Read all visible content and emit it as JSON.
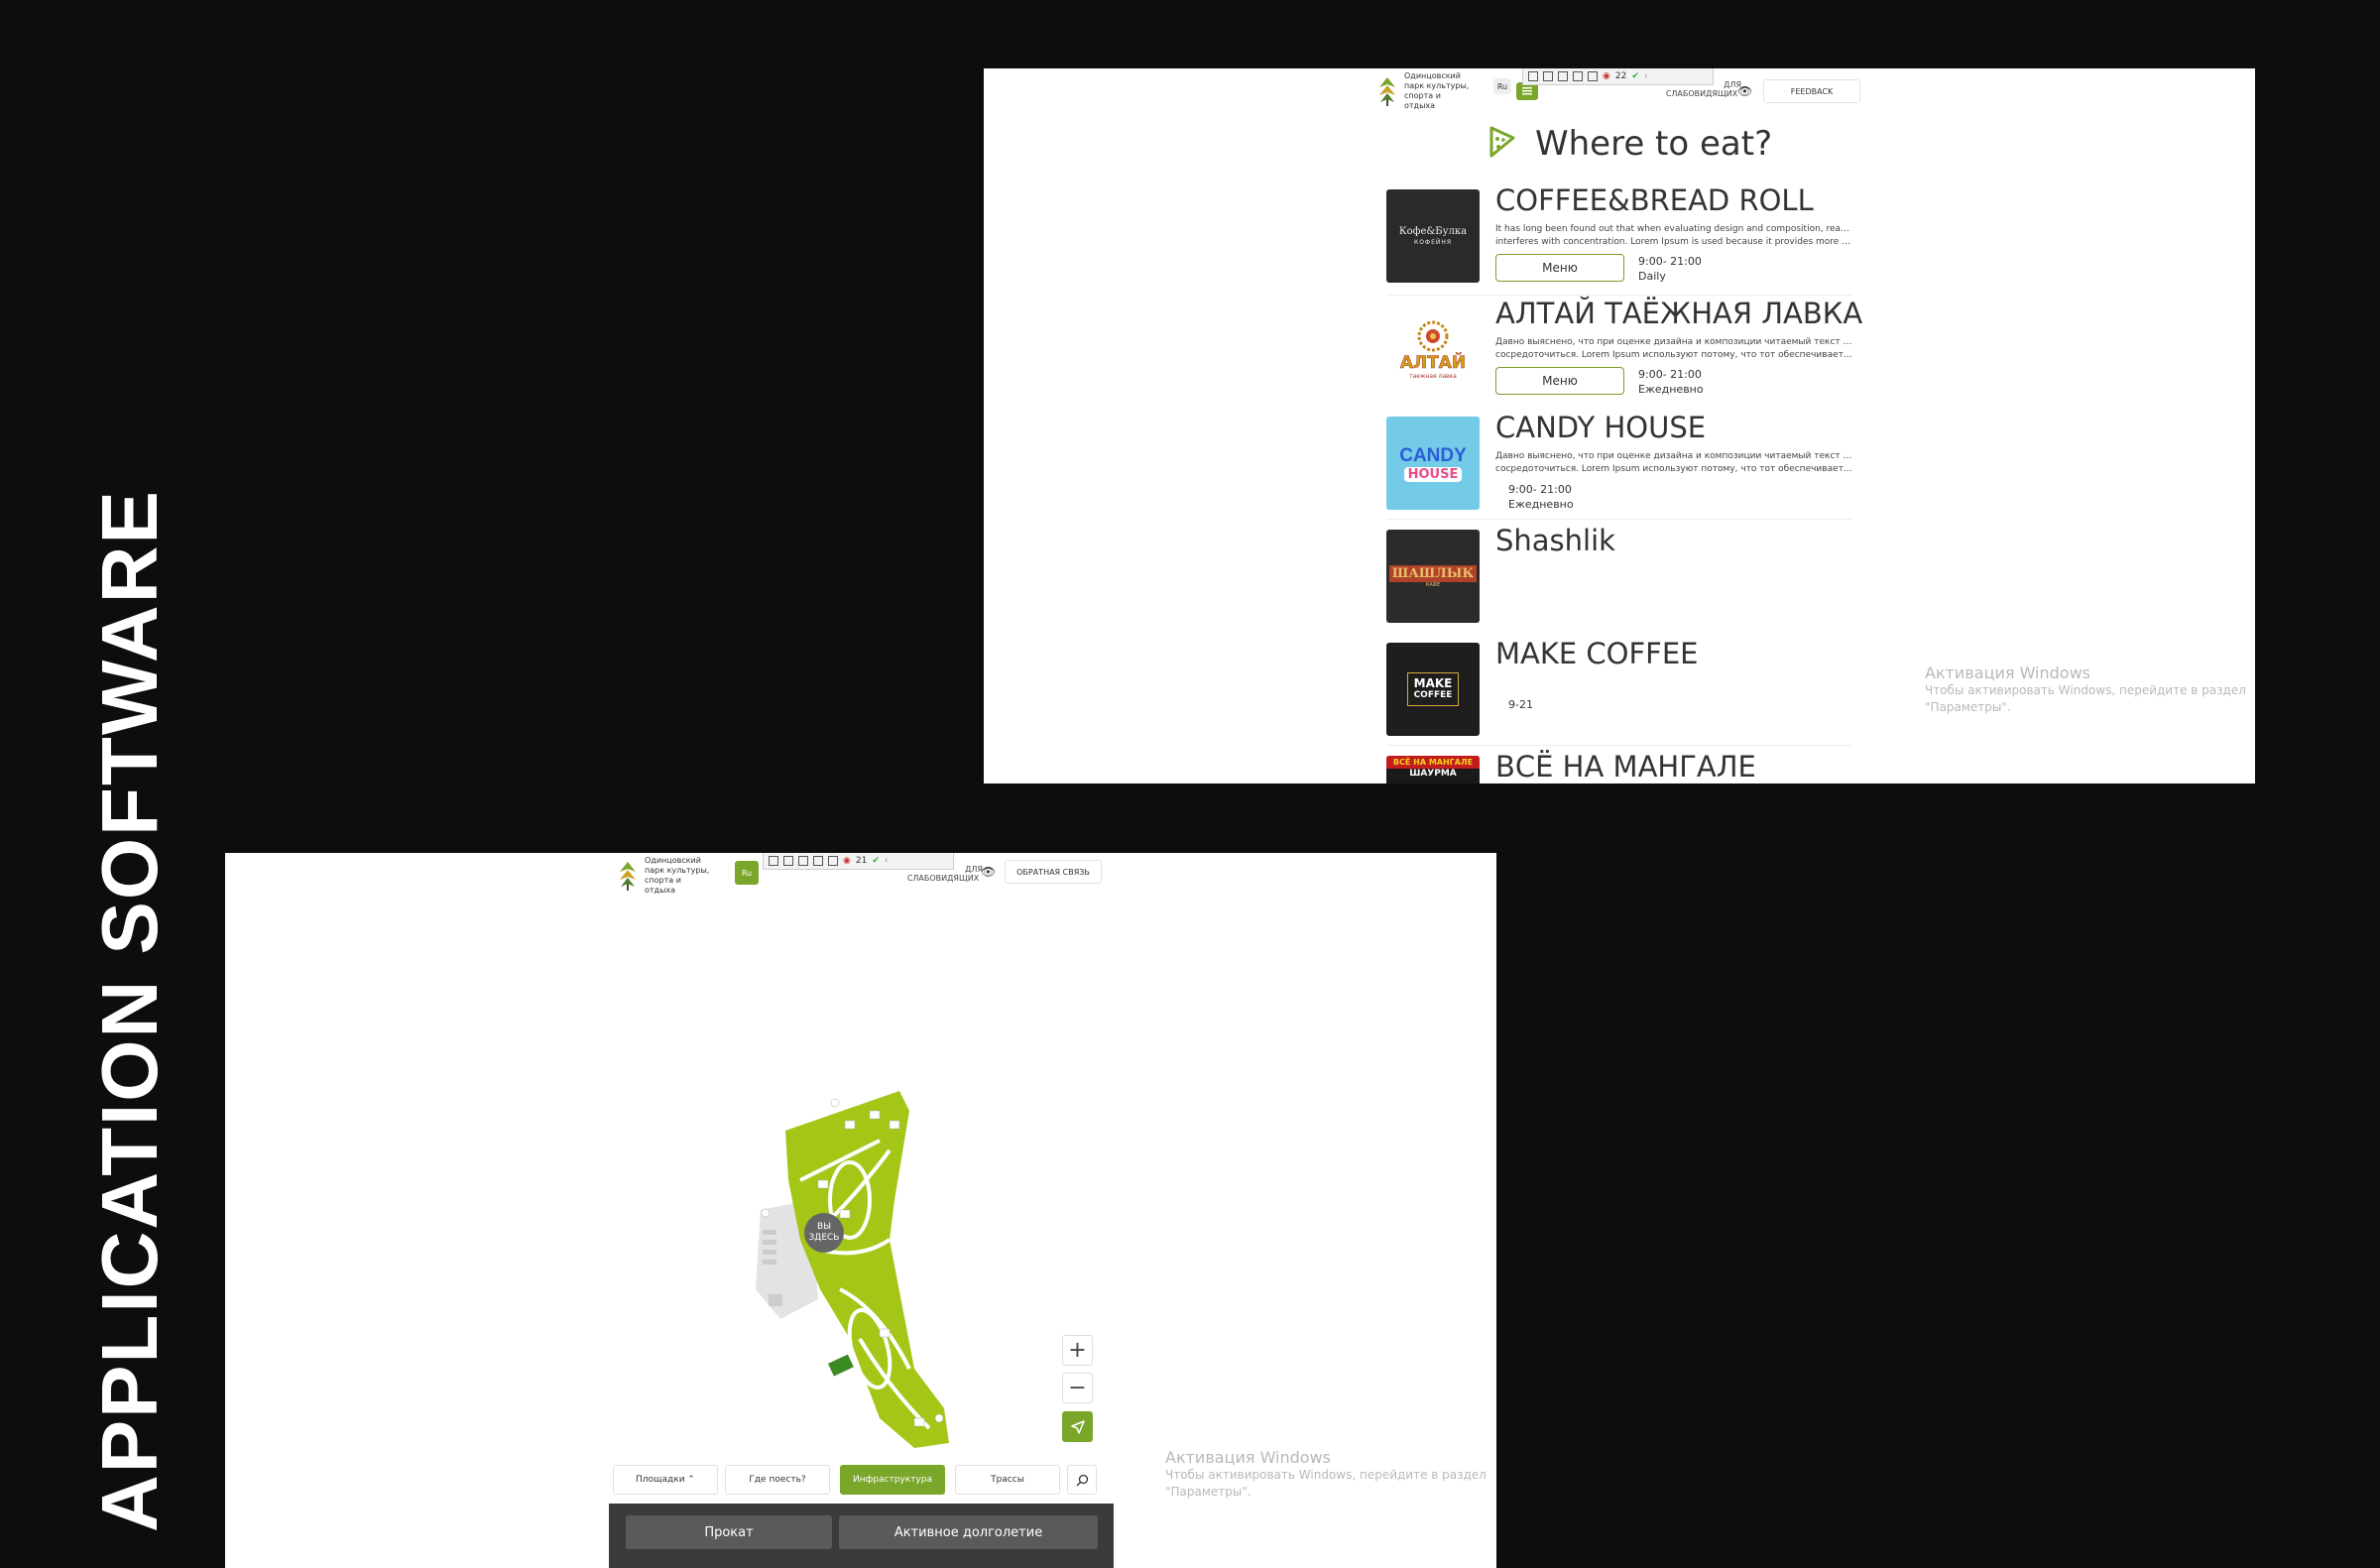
{
  "page_title": "APPLICATION SOFTWARE",
  "colors": {
    "background": "#0d0d0d",
    "accent_green": "#7aa62a",
    "map_green": "#a3c617"
  },
  "eat_screen": {
    "header": {
      "logo_text": [
        "Одинцовский",
        "парк культуры,",
        "спорта и отдыха"
      ],
      "lang_label": "Ru",
      "toolbar_count": "22",
      "accessibility_label": [
        "ДЛЯ",
        "СЛАБОВИДЯЩИХ"
      ],
      "feedback_label": "FEEDBACK"
    },
    "title": "Where to eat?",
    "restaurants": [
      {
        "name": "COFFEE&BREAD ROLL",
        "logo_text": "Кофе&Булка",
        "logo_sub": "КОФЕЙНЯ",
        "description": [
          "It has long been found out that when evaluating design and composition, readable text",
          "interferes with concentration. Lorem Ipsum is used because it provides more or less"
        ],
        "menu_button": "Меню",
        "hours": "9:00- 21:00",
        "days": "Daily"
      },
      {
        "name": "АЛТАЙ ТАЁЖНАЯ ЛАВКА",
        "logo_text": "АЛТАЙ",
        "logo_sub": "таежная лавка",
        "description": [
          "Давно выяснено, что при оценке дизайна и композиции читаемый текст мешает",
          "сосредоточиться. Lorem Ipsum используют потому, что тот обеспечивает более и..."
        ],
        "menu_button": "Меню",
        "hours": "9:00- 21:00",
        "days": "Ежедневно"
      },
      {
        "name": "CANDY HOUSE",
        "logo_text": "CANDY",
        "logo_sub": "HOUSE",
        "description": [
          "Давно выяснено, что при оценке дизайна и композиции читаемый текст мешает",
          "сосредоточиться. Lorem Ipsum используют потому, что тот обеспечивает более и..."
        ],
        "hours": "9:00- 21:00",
        "days": "Ежедневно"
      },
      {
        "name": "Shashlik",
        "logo_text": "ШАШЛЫК",
        "logo_sub": "КАФЕ"
      },
      {
        "name": "MAKE COFFEE",
        "logo_text": "MAKE",
        "logo_sub": "COFFEE",
        "hours": "9-21"
      },
      {
        "name": "ВСЁ НА МАНГАЛЕ",
        "logo_text": "ВСЁ НА МАНГАЛЕ",
        "logo_sub": "ШАУРМА"
      }
    ],
    "watermark": {
      "title": "Активация Windows",
      "line1": "Чтобы активировать Windows, перейдите в раздел",
      "line2": "\"Параметры\"."
    }
  },
  "map_screen": {
    "header": {
      "logo_text": [
        "Одинцовский",
        "парк культуры,",
        "спорта и отдыха"
      ],
      "lang_label": "Ru",
      "toolbar_count": "21",
      "accessibility_label": [
        "ДЛЯ",
        "СЛАБОВИДЯЩИХ"
      ],
      "feedback_label": "ОБРАТНАЯ СВЯЗЬ"
    },
    "you_are_here": [
      "ВЫ",
      "ЗДЕСЬ"
    ],
    "zoom_in": "+",
    "zoom_out": "−",
    "tabs": [
      {
        "label": "Площадки ⌃",
        "active": false
      },
      {
        "label": "Где поесть?",
        "active": false
      },
      {
        "label": "Инфраструктура",
        "active": true
      },
      {
        "label": "Трассы",
        "active": false
      }
    ],
    "bottom_buttons": [
      "Прокат",
      "Активное долголетие"
    ],
    "watermark": {
      "title": "Активация Windows",
      "line1": "Чтобы активировать Windows, перейдите в раздел",
      "line2": "\"Параметры\"."
    }
  }
}
